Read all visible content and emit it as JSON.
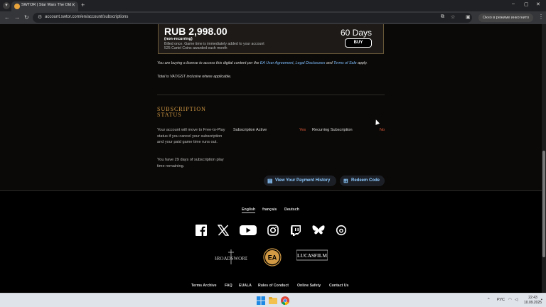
{
  "browser": {
    "tab_title": "SWTOR | Star Wars The Old Re",
    "new_tab": "+",
    "url": "account.swtor.com/en/account/subscriptions",
    "incognito_label": "Окно в режиме инкогнито"
  },
  "purchase": {
    "price": "RUB 2,998.00",
    "non_recurring": "(non-recurring)",
    "desc_line1": "Billed once. Game time is immediately added to your account",
    "desc_line2": "525 Cartel Coins awarded each month",
    "duration": "60 Days",
    "buy_label": "BUY"
  },
  "legal": {
    "prefix": "You are buying a license to access this digital content per the ",
    "link1": "EA User Agreement",
    "sep1": ", ",
    "link2": "Legal Disclosures",
    "sep2": " and ",
    "link3": "Terms of Sale",
    "suffix": " apply.",
    "vat": "Total is VAT/GST inclusive where applicable."
  },
  "subscription_status": {
    "title_line1": "SUBSCRIPTION",
    "title_line2": "STATUS",
    "free_to_play_note": "Your account will move to Free-to-Play status if you cancel your subscription and your paid game time runs out.",
    "days_remaining_note": "You have 29 days of subscription play time remaining.",
    "active_label": "Subscription Active",
    "active_value": "Yes",
    "recurring_label": "Recurring Subscription",
    "recurring_value": "No",
    "payment_history_button": "View Your Payment History",
    "redeem_button": "Redeem Code"
  },
  "footer": {
    "languages": [
      "English",
      "français",
      "Deutsch"
    ],
    "active_language": "English",
    "social_icons": [
      "facebook-icon",
      "x-icon",
      "youtube-icon",
      "instagram-icon",
      "twitch-icon",
      "bluesky-icon",
      "threads-icon"
    ],
    "partners": [
      "BROADSWORD",
      "EA",
      "LUCASFILM"
    ],
    "links": [
      "Terms Archive",
      "FAQ",
      "EUALA",
      "Rules of Conduct",
      "Online Safety",
      "Contact Us"
    ]
  },
  "taskbar": {
    "lang": "РУС",
    "time": "22:43",
    "date": "10.09.2025"
  },
  "colors": {
    "accent_gold": "#d29a44",
    "link_blue": "#7fbfff",
    "status_red": "#e05a3a",
    "page_bg": "#0b0907"
  }
}
